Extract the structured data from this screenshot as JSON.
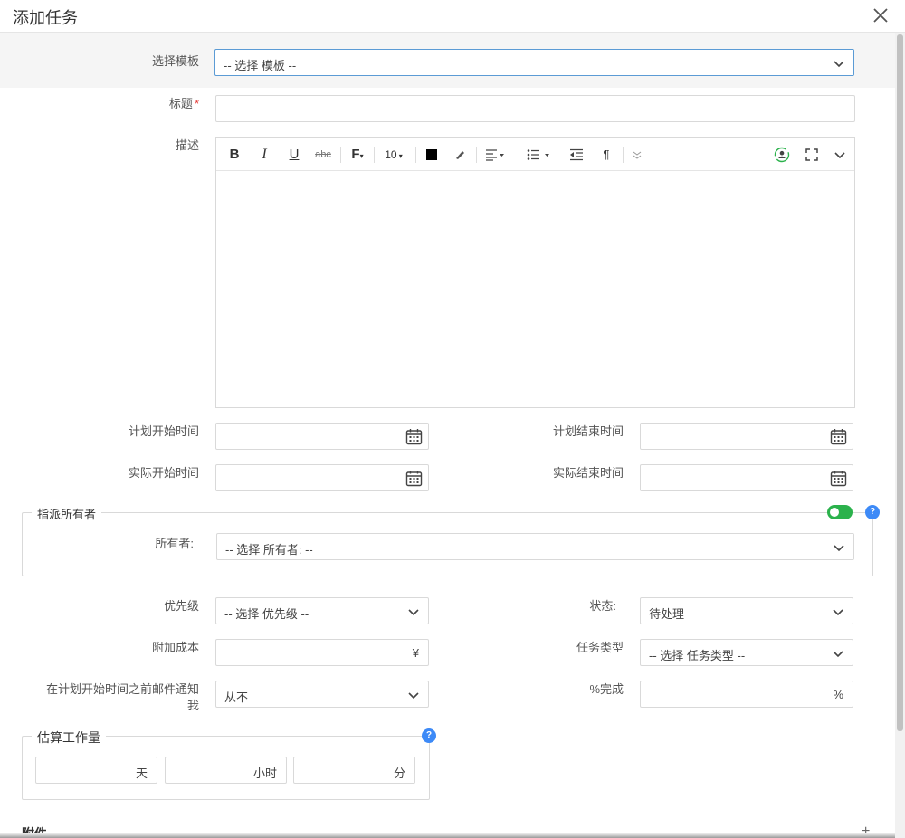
{
  "dialog": {
    "title": "添加任务"
  },
  "template": {
    "label": "选择模板",
    "value": "-- 选择 模板 --"
  },
  "title_field": {
    "label": "标题",
    "required_mark": "*",
    "value": ""
  },
  "description": {
    "label": "描述",
    "font_size": "10"
  },
  "planned_start": {
    "label": "计划开始时间",
    "value": ""
  },
  "planned_end": {
    "label": "计划结束时间",
    "value": ""
  },
  "actual_start": {
    "label": "实际开始时间",
    "value": ""
  },
  "actual_end": {
    "label": "实际结束时间",
    "value": ""
  },
  "assign_owner": {
    "legend": "指派所有者",
    "help": "?",
    "toggle_on": true,
    "owner_label": "所有者:",
    "owner_value": "-- 选择 所有者: --"
  },
  "priority": {
    "label": "优先级",
    "value": "-- 选择 优先级 --"
  },
  "status": {
    "label": "状态:",
    "value": "待处理"
  },
  "extra_cost": {
    "label": "附加成本",
    "suffix": "¥",
    "value": ""
  },
  "task_type": {
    "label": "任务类型",
    "value": "-- 选择 任务类型 --"
  },
  "email_notify": {
    "label_line1": "在计划开始时间之前邮件通知",
    "label_line2": "我",
    "value": "从不"
  },
  "percent_done": {
    "label": "%完成",
    "suffix": "%",
    "value": ""
  },
  "estimate": {
    "legend": "估算工作量",
    "help": "?",
    "days_unit": "天",
    "hours_unit": "小时",
    "minutes_unit": "分"
  },
  "attachments": {
    "label": "附件",
    "add": "+"
  },
  "colors": {
    "accent": "#3d8af7",
    "toggle": "#2bb24c",
    "required": "#e53935"
  }
}
